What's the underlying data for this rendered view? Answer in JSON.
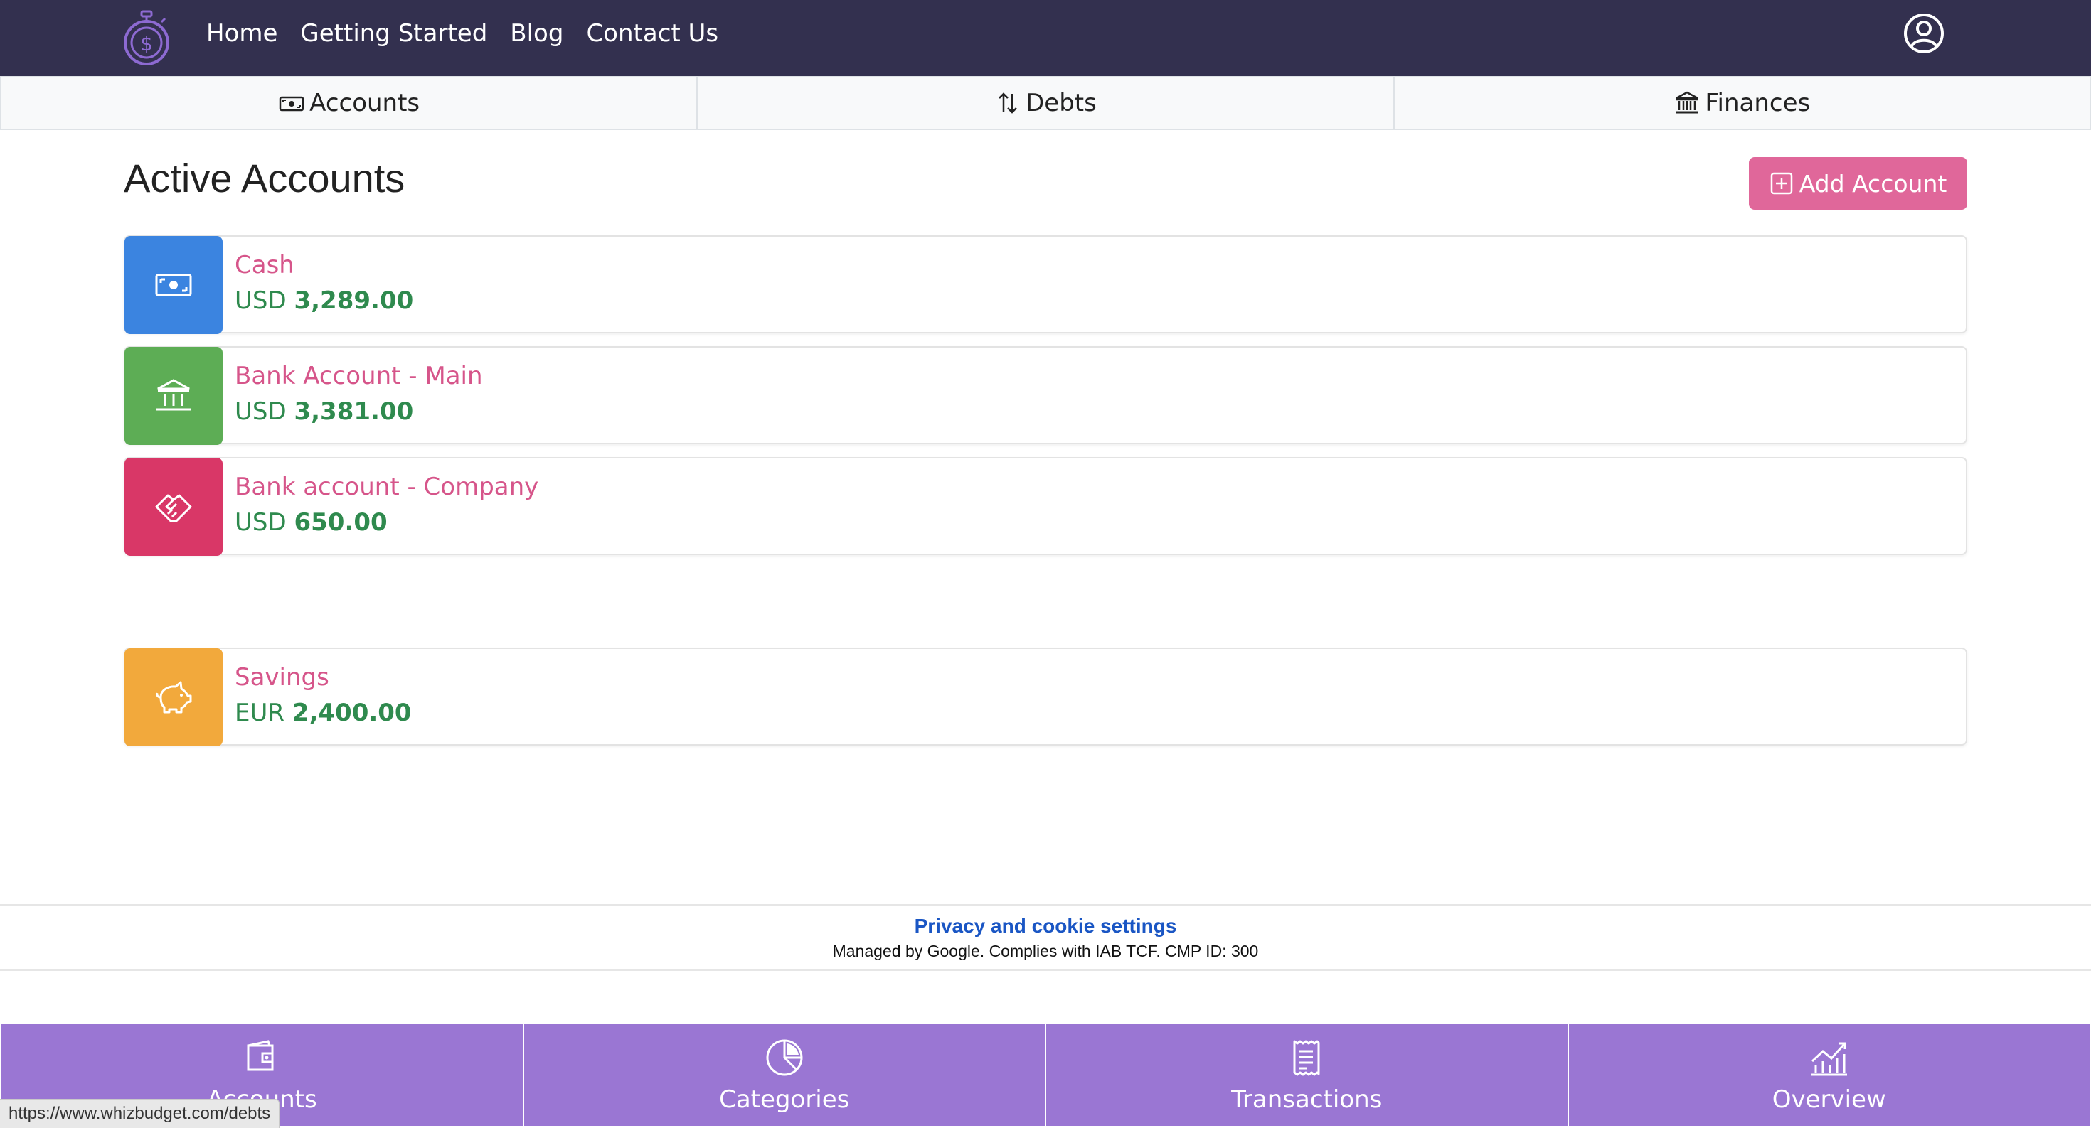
{
  "navbar": {
    "links": [
      "Home",
      "Getting Started",
      "Blog",
      "Contact Us"
    ]
  },
  "tabs": [
    {
      "label": "Accounts",
      "icon": "cash-icon"
    },
    {
      "label": "Debts",
      "icon": "arrows-up-down-icon"
    },
    {
      "label": "Finances",
      "icon": "bank-icon"
    }
  ],
  "main": {
    "title": "Active Accounts",
    "add_button_label": "Add Account"
  },
  "accounts": [
    {
      "name": "Cash",
      "currency": "USD",
      "amount": "3,289.00",
      "color": "#3b84e0",
      "icon": "cash-icon"
    },
    {
      "name": "Bank Account - Main",
      "currency": "USD",
      "amount": "3,381.00",
      "color": "#5dad55",
      "icon": "bank-icon"
    },
    {
      "name": "Bank account - Company",
      "currency": "USD",
      "amount": "650.00",
      "color": "#d93767",
      "icon": "handshake-icon"
    },
    {
      "name": "Savings",
      "currency": "EUR",
      "amount": "2,400.00",
      "color": "#f2a93c",
      "icon": "piggy-bank-icon"
    }
  ],
  "privacy": {
    "link": "Privacy and cookie settings",
    "note": "Managed by Google. Complies with IAB TCF. CMP ID: 300"
  },
  "bottom_nav": [
    {
      "label": "Accounts",
      "icon": "wallet-icon"
    },
    {
      "label": "Categories",
      "icon": "pie-chart-icon"
    },
    {
      "label": "Transactions",
      "icon": "receipt-icon"
    },
    {
      "label": "Overview",
      "icon": "graph-up-icon"
    }
  ],
  "status_url": "https://www.whizbudget.com/debts"
}
